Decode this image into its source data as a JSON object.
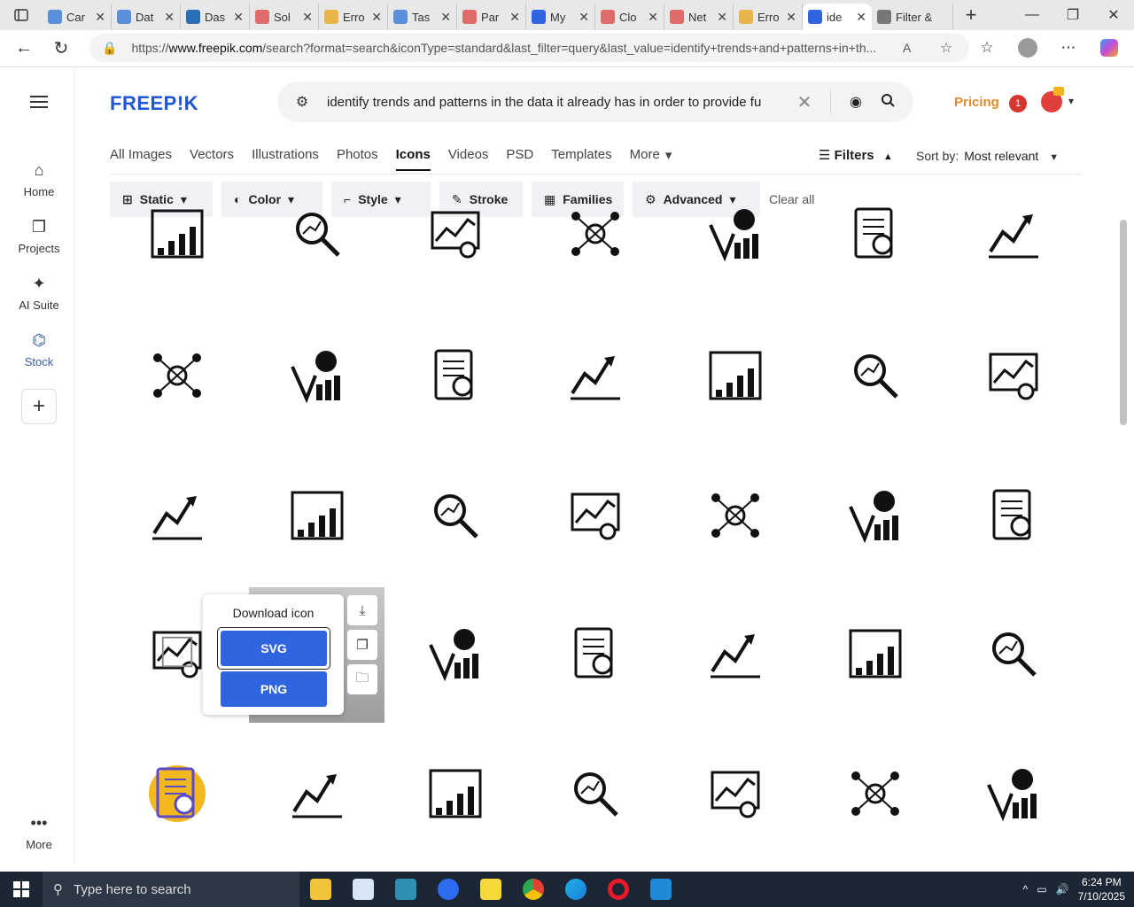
{
  "browser": {
    "tabs": [
      {
        "label": "Car",
        "color": "#5b8fd9"
      },
      {
        "label": "Dat",
        "color": "#5b8fd9"
      },
      {
        "label": "Das",
        "color": "#2a6fb6"
      },
      {
        "label": "Sol",
        "color": "#e06b6b"
      },
      {
        "label": "Erro",
        "color": "#e9b44c"
      },
      {
        "label": "Tas",
        "color": "#5b8fd9"
      },
      {
        "label": "Par",
        "color": "#e06b6b"
      },
      {
        "label": "My",
        "color": "#2f66e0"
      },
      {
        "label": "Clo",
        "color": "#e06b6b"
      },
      {
        "label": "Net",
        "color": "#e06b6b"
      },
      {
        "label": "Erro",
        "color": "#e9b44c"
      },
      {
        "label": "ide",
        "color": "#2f66e0",
        "active": true
      },
      {
        "label": "Filter &",
        "color": "#777777"
      }
    ],
    "url_prefix": "https://",
    "url_domain": "www.freepik.com",
    "url_rest": "/search?format=search&iconType=standard&last_filter=query&last_value=identify+trends+and+patterns+in+th..."
  },
  "sidebar": {
    "items": [
      {
        "label": "Home",
        "icon": "home-icon"
      },
      {
        "label": "Projects",
        "icon": "projects-icon"
      },
      {
        "label": "AI Suite",
        "icon": "sparkle-icon"
      },
      {
        "label": "Stock",
        "icon": "stock-icon"
      }
    ],
    "more_label": "More"
  },
  "header": {
    "logo": "FREEP!K",
    "search_text": "identify trends and patterns in the data it already has in order to provide fu",
    "pricing": "Pricing",
    "notification_count": "1"
  },
  "type_tabs": [
    "All Images",
    "Vectors",
    "Illustrations",
    "Photos",
    "Icons",
    "Videos",
    "PSD",
    "Templates",
    "More"
  ],
  "active_tab": "Icons",
  "filters_label": "Filters",
  "sort": {
    "label": "Sort by:",
    "value": "Most relevant"
  },
  "chips": [
    "Static",
    "Color",
    "Style",
    "Stroke",
    "Families",
    "Advanced"
  ],
  "clear_all": "Clear all",
  "popup": {
    "title": "Download icon",
    "svg": "SVG",
    "png": "PNG"
  },
  "taskbar": {
    "search_placeholder": "Type here to search",
    "time": "6:24 PM",
    "date": "7/10/2025"
  }
}
